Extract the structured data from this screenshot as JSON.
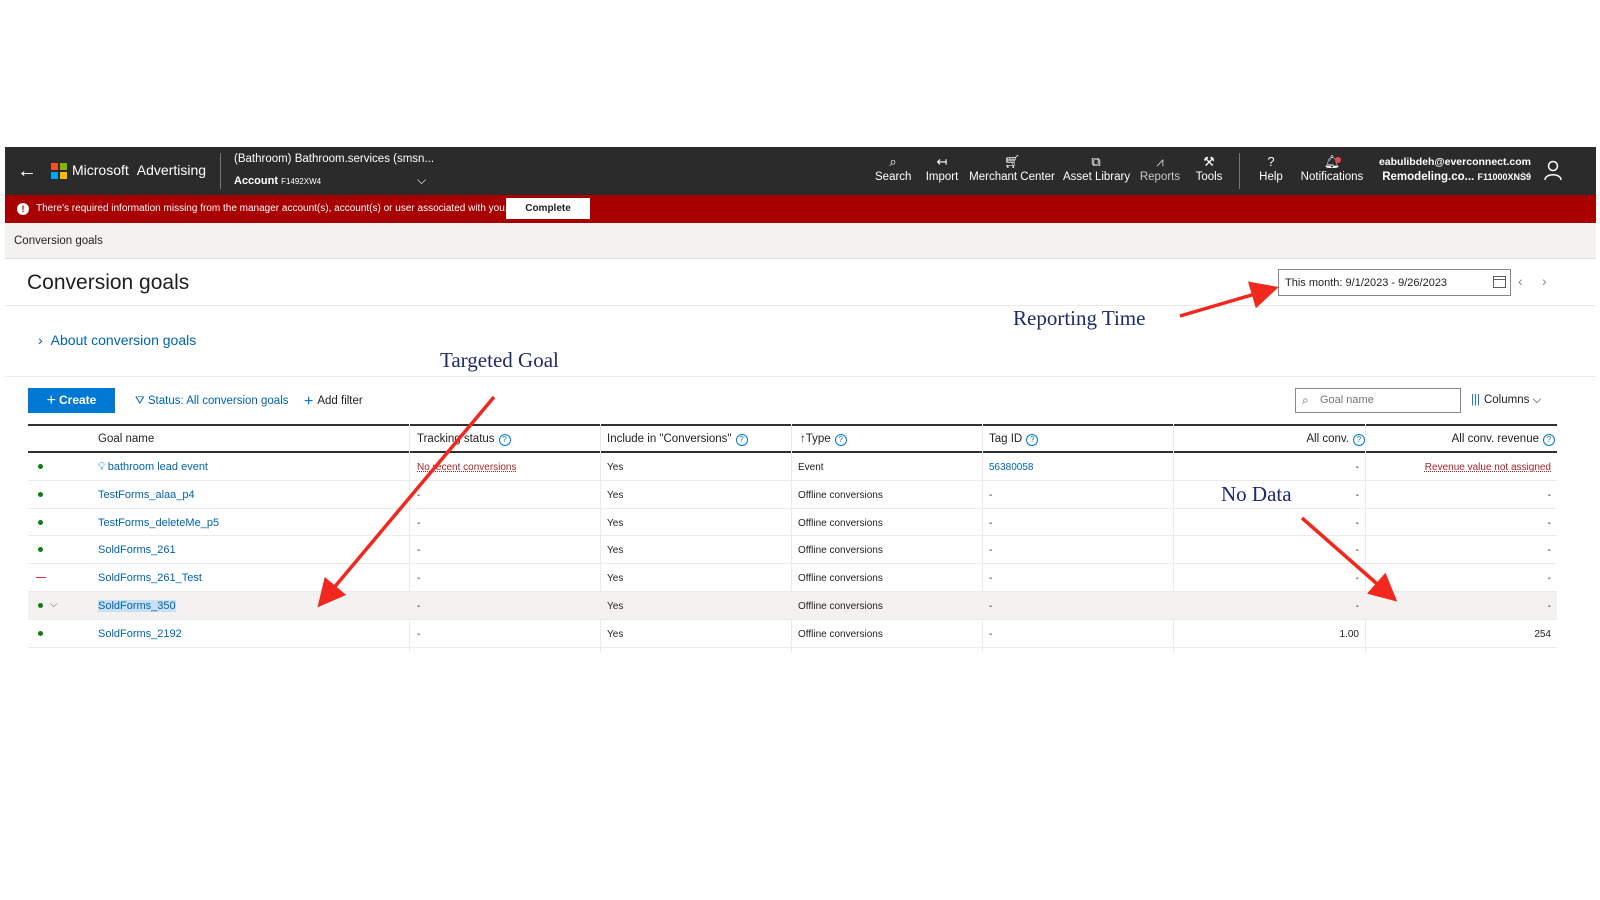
{
  "header": {
    "brand_microsoft": "Microsoft",
    "brand_product": "Advertising",
    "account_name": "(Bathroom) Bathroom.services (smsn...",
    "account_label": "Account",
    "account_id": "F1492XW4",
    "nav": [
      {
        "label": "Search",
        "icon": "search-icon"
      },
      {
        "label": "Import",
        "icon": "import-icon"
      },
      {
        "label": "Merchant Center",
        "icon": "cart-icon"
      },
      {
        "label": "Asset Library",
        "icon": "asset-library-icon"
      },
      {
        "label": "Reports",
        "icon": "reports-icon"
      },
      {
        "label": "Tools",
        "icon": "tools-icon"
      },
      {
        "label": "Help",
        "icon": "help-icon"
      },
      {
        "label": "Notifications",
        "icon": "bell-icon"
      }
    ],
    "user_email": "eabulibdeh@everconnect.com",
    "user_org": "Remodeling.co...",
    "user_customer_id": "F11000XNS9"
  },
  "alert": {
    "text": "There's required information missing from the manager account(s), account(s) or user associated with you.",
    "button": "Complete"
  },
  "breadcrumb": "Conversion goals",
  "page_title": "Conversion goals",
  "date_range": "This month: 9/1/2023 - 9/26/2023",
  "about_link": "About conversion goals",
  "toolbar": {
    "create": "Create",
    "status_filter": "Status: All conversion goals",
    "add_filter": "Add filter",
    "search_placeholder": "Goal name",
    "columns": "Columns"
  },
  "table": {
    "headers": {
      "goal_name": "Goal name",
      "tracking_status": "Tracking status",
      "include": "Include in \"Conversions\"",
      "type": "Type",
      "tag_id": "Tag ID",
      "all_conv": "All conv.",
      "all_conv_revenue": "All conv. revenue"
    },
    "rows": [
      {
        "status": "active",
        "name": "bathroom lead event",
        "tracking": "No recent conversions",
        "include": "Yes",
        "type": "Event",
        "tag_id": "56380058",
        "all_conv": "-",
        "revenue": "Revenue value not assigned"
      },
      {
        "status": "active",
        "name": "TestForms_alaa_p4",
        "tracking": "-",
        "include": "Yes",
        "type": "Offline conversions",
        "tag_id": "-",
        "all_conv": "-",
        "revenue": "-"
      },
      {
        "status": "active",
        "name": "TestForms_deleteMe_p5",
        "tracking": "-",
        "include": "Yes",
        "type": "Offline conversions",
        "tag_id": "-",
        "all_conv": "-",
        "revenue": "-"
      },
      {
        "status": "active",
        "name": "SoldForms_261",
        "tracking": "-",
        "include": "Yes",
        "type": "Offline conversions",
        "tag_id": "-",
        "all_conv": "-",
        "revenue": "-"
      },
      {
        "status": "paused",
        "name": "SoldForms_261_Test",
        "tracking": "-",
        "include": "Yes",
        "type": "Offline conversions",
        "tag_id": "-",
        "all_conv": "-",
        "revenue": "-"
      },
      {
        "status": "active",
        "name": "SoldForms_350",
        "tracking": "-",
        "include": "Yes",
        "type": "Offline conversions",
        "tag_id": "-",
        "all_conv": "-",
        "revenue": "-"
      },
      {
        "status": "active",
        "name": "SoldForms_2192",
        "tracking": "-",
        "include": "Yes",
        "type": "Offline conversions",
        "tag_id": "-",
        "all_conv": "1.00",
        "revenue": "254"
      }
    ]
  },
  "annotations": {
    "reporting_time": "Reporting Time",
    "targeted_goal": "Targeted Goal",
    "no_data": "No Data"
  },
  "colors": {
    "topbar": "#2b2b2b",
    "alert": "#a80000",
    "accent": "#0078d4",
    "arrow": "#f0281e",
    "annotation_text": "#1f2a6b"
  }
}
